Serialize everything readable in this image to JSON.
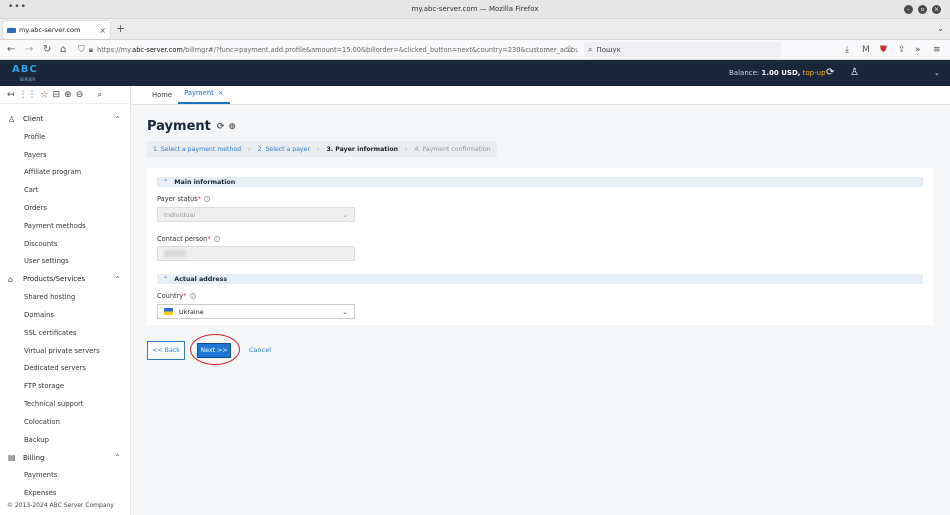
{
  "browser": {
    "window_title": "my.abc-server.com — Mozilla Firefox",
    "tab_label": "my.abc-server.com",
    "url_prefix": "https://my.",
    "url_domain": "abc-server.com",
    "url_rest": "/billmgr#/?func=payment.add.profile&amount=15.00&billorder=&clicked_button=next&country=230&customer_accou",
    "search_placeholder": "Пошук"
  },
  "header": {
    "logo_text": "ABC",
    "logo_sub": "SERVER",
    "balance_label": "Balance: ",
    "balance_value": "1.00 USD,",
    "topup_label": "top-up"
  },
  "sidebar": {
    "client": {
      "label": "Client",
      "items": [
        "Profile",
        "Payers",
        "Affiliate program",
        "Cart",
        "Orders",
        "Payment methods",
        "Discounts",
        "User settings"
      ]
    },
    "products": {
      "label": "Products/Services",
      "items": [
        "Shared hosting",
        "Domains",
        "SSL certificates",
        "Virtual private servers",
        "Dedicated servers",
        "FTP storage",
        "Technical support",
        "Colocation",
        "Backup"
      ]
    },
    "billing": {
      "label": "Billing",
      "items": [
        "Payments",
        "Expenses"
      ]
    },
    "copyright": "© 2013-2024 ABC Server Company"
  },
  "topnav": {
    "home": "Home",
    "payment": "Payment",
    "close": "×"
  },
  "page": {
    "title": "Payment",
    "steps": {
      "step1": "1. Select a payment method",
      "step2": "2. Select a payer",
      "step3": "3. Payer information",
      "step4": "4. Payment confirmation"
    },
    "main_info": {
      "title": "Main information",
      "payer_status_label": "Payer status",
      "payer_status_value": "Individual",
      "contact_label": "Contact person"
    },
    "address": {
      "title": "Actual address",
      "country_label": "Country",
      "country_value": "Ukraine"
    },
    "buttons": {
      "back": "<< Back",
      "next": "Next >>",
      "cancel": "Cancel"
    }
  },
  "colors": {
    "header_bg": "#1a2639",
    "accent": "#1f76d4",
    "topup": "#f6b51a",
    "highlight_ring": "#d4242b"
  }
}
